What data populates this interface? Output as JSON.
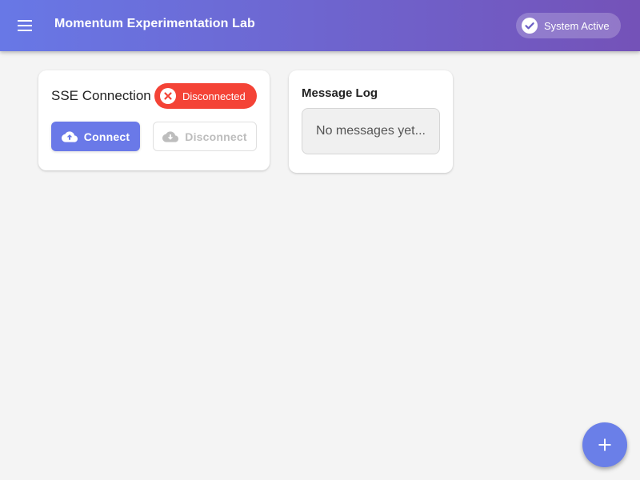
{
  "appbar": {
    "title": "Momentum Experimentation Lab",
    "menu_icon": "menu-icon",
    "system_status": {
      "label": "System Active",
      "icon": "check-circle-icon"
    }
  },
  "sse_card": {
    "title": "SSE Connection",
    "status": {
      "label": "Disconnected",
      "icon": "cancel-circle-icon",
      "color": "#f44336"
    },
    "connect_button": {
      "label": "Connect",
      "icon": "cloud-upload-icon",
      "enabled": true
    },
    "disconnect_button": {
      "label": "Disconnect",
      "icon": "cloud-download-icon",
      "enabled": false
    }
  },
  "message_log": {
    "title": "Message Log",
    "empty_text": "No messages yet..."
  },
  "fab": {
    "icon": "plus-icon"
  },
  "colors": {
    "appbar_gradient_start": "#6878e6",
    "appbar_gradient_end": "#7452b8",
    "primary": "#6a79e8",
    "error": "#f44336",
    "background": "#f4f4f4"
  }
}
